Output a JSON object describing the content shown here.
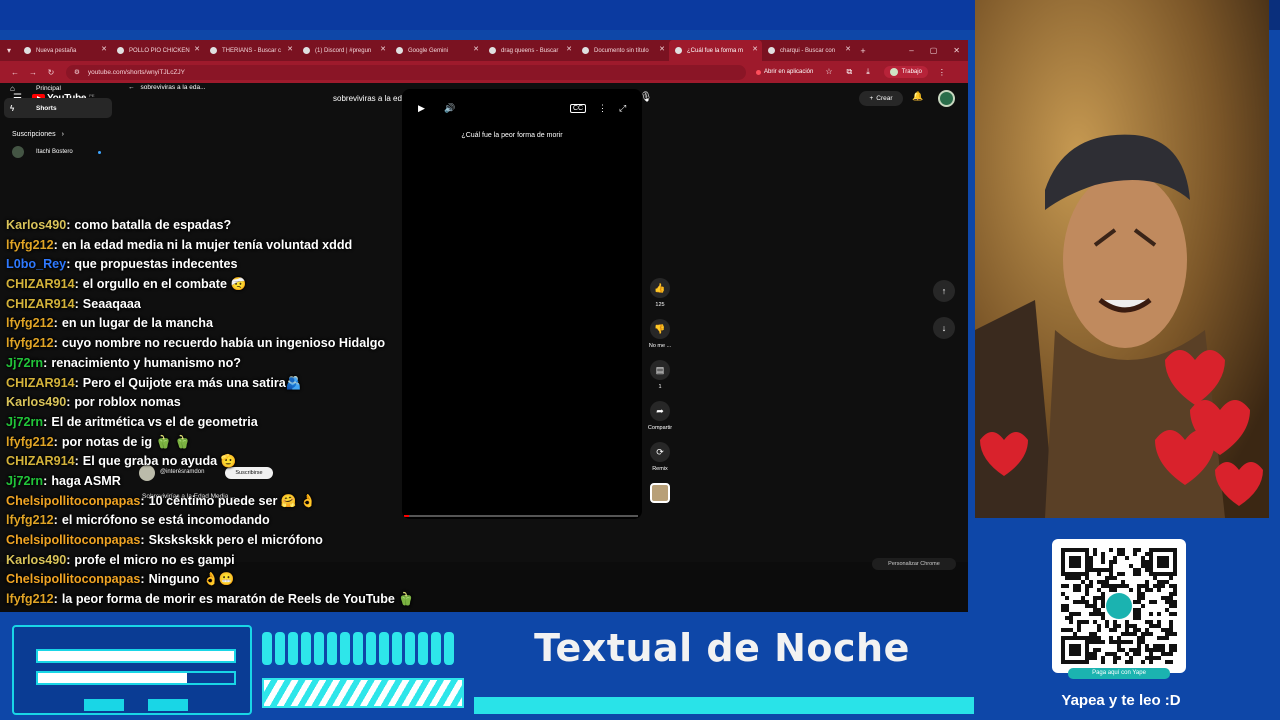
{
  "browser": {
    "tabs": [
      {
        "label": "Nueva pestaña",
        "active": false
      },
      {
        "label": "POLLO PIO CHICKEN",
        "active": false
      },
      {
        "label": "THERIANS - Buscar c",
        "active": false
      },
      {
        "label": "(1) Discord | #pregun",
        "active": false
      },
      {
        "label": "Google Gemini",
        "active": false
      },
      {
        "label": "drag queens - Buscar",
        "active": false
      },
      {
        "label": "Documento sin título",
        "active": false
      },
      {
        "label": "¿Cuál fue la forma m",
        "active": true
      },
      {
        "label": "charqui - Buscar con",
        "active": false
      }
    ],
    "url": "youtube.com/shorts/wnyiTJLcZJY",
    "open_in_app": "Abrir en aplicación",
    "profile_label": "Trabajo",
    "personalize": "Personalizar Chrome"
  },
  "youtube": {
    "logo": "YouTube",
    "region": "PE",
    "search_value": "sobreviviras a la edad media",
    "create_label": "Crear",
    "back_label": "sobreviviras a la eda...",
    "sidebar": {
      "items": [
        {
          "label": "Principal",
          "icon": "home-icon",
          "active": false
        },
        {
          "label": "Shorts",
          "icon": "shorts-icon",
          "active": true
        }
      ],
      "subscriptions_header": "Suscripciones",
      "subscriptions": [
        {
          "name": "Itachi Bostero",
          "live": true
        }
      ]
    },
    "video": {
      "title": "¿Cuál fue la peor forma de morir",
      "channel": "@interésramdon",
      "subscribe": "Suscribirse",
      "description": "Sobrevivirías a la Edad Media ...",
      "progress": 0.02
    },
    "actions": {
      "likes": "125",
      "dislike": "No me ...",
      "comments": "1",
      "share": "Compartir",
      "remix": "Remix"
    }
  },
  "chat": [
    {
      "user": "Karlos490",
      "color": "#d9c35a",
      "text": "como batalla de espadas?"
    },
    {
      "user": "lfyfg212",
      "color": "#e0a426",
      "text": "en la edad media ni la mujer tenía voluntad xddd"
    },
    {
      "user": "L0bo_Rey",
      "color": "#2f79ff",
      "text": "que propuestas indecentes"
    },
    {
      "user": "CHIZAR914",
      "color": "#d4b33b",
      "text": "el orgullo en el combate 🤕"
    },
    {
      "user": "CHIZAR914",
      "color": "#d4b33b",
      "text": "Seaaqaaa"
    },
    {
      "user": "lfyfg212",
      "color": "#e0a426",
      "text": "en un lugar de la mancha"
    },
    {
      "user": "lfyfg212",
      "color": "#e0a426",
      "text": "cuyo nombre no recuerdo había un ingenioso Hidalgo"
    },
    {
      "user": "Jj72rn",
      "color": "#22c53a",
      "text": "renacimiento y humanismo no?"
    },
    {
      "user": "CHIZAR914",
      "color": "#d4b33b",
      "text": "Pero el Quijote era más una satira🫂"
    },
    {
      "user": "Karlos490",
      "color": "#d9c35a",
      "text": "por roblox nomas"
    },
    {
      "user": "Jj72rn",
      "color": "#22c53a",
      "text": "El de aritmética vs el de geometria"
    },
    {
      "user": "lfyfg212",
      "color": "#e0a426",
      "text": "por notas de ig 🫑 🫑"
    },
    {
      "user": "CHIZAR914",
      "color": "#d4b33b",
      "text": "El que graba no ayuda 🫡"
    },
    {
      "user": "Jj72rn",
      "color": "#22c53a",
      "text": "haga ASMR"
    },
    {
      "user": "Chelsipollitoconpapas",
      "color": "#f0a424",
      "text": "10 céntimo puede ser 🤗 👌"
    },
    {
      "user": "lfyfg212",
      "color": "#e0a426",
      "text": "el micrófono se está incomodando"
    },
    {
      "user": "Chelsipollitoconpapas",
      "color": "#f0a424",
      "text": "Skskskskk pero el micrófono"
    },
    {
      "user": "Karlos490",
      "color": "#d9c35a",
      "text": "profe el micro no es gampi"
    },
    {
      "user": "Chelsipollitoconpapas",
      "color": "#f0a424",
      "text": "Ninguno 👌😬"
    },
    {
      "user": "lfyfg212",
      "color": "#e0a426",
      "text": "la peor forma de morir es maratón de Reels de YouTube 🫑"
    }
  ],
  "overlay": {
    "title": "Textual de Noche",
    "qr_caption": "Paga aquí con Yape",
    "yape_label": "Yapea y te leo :D",
    "meter_fill": 0.76
  },
  "colors": {
    "background": "#0e47a8",
    "accent": "#29e3e8",
    "tab_strip": "#7a1221"
  }
}
